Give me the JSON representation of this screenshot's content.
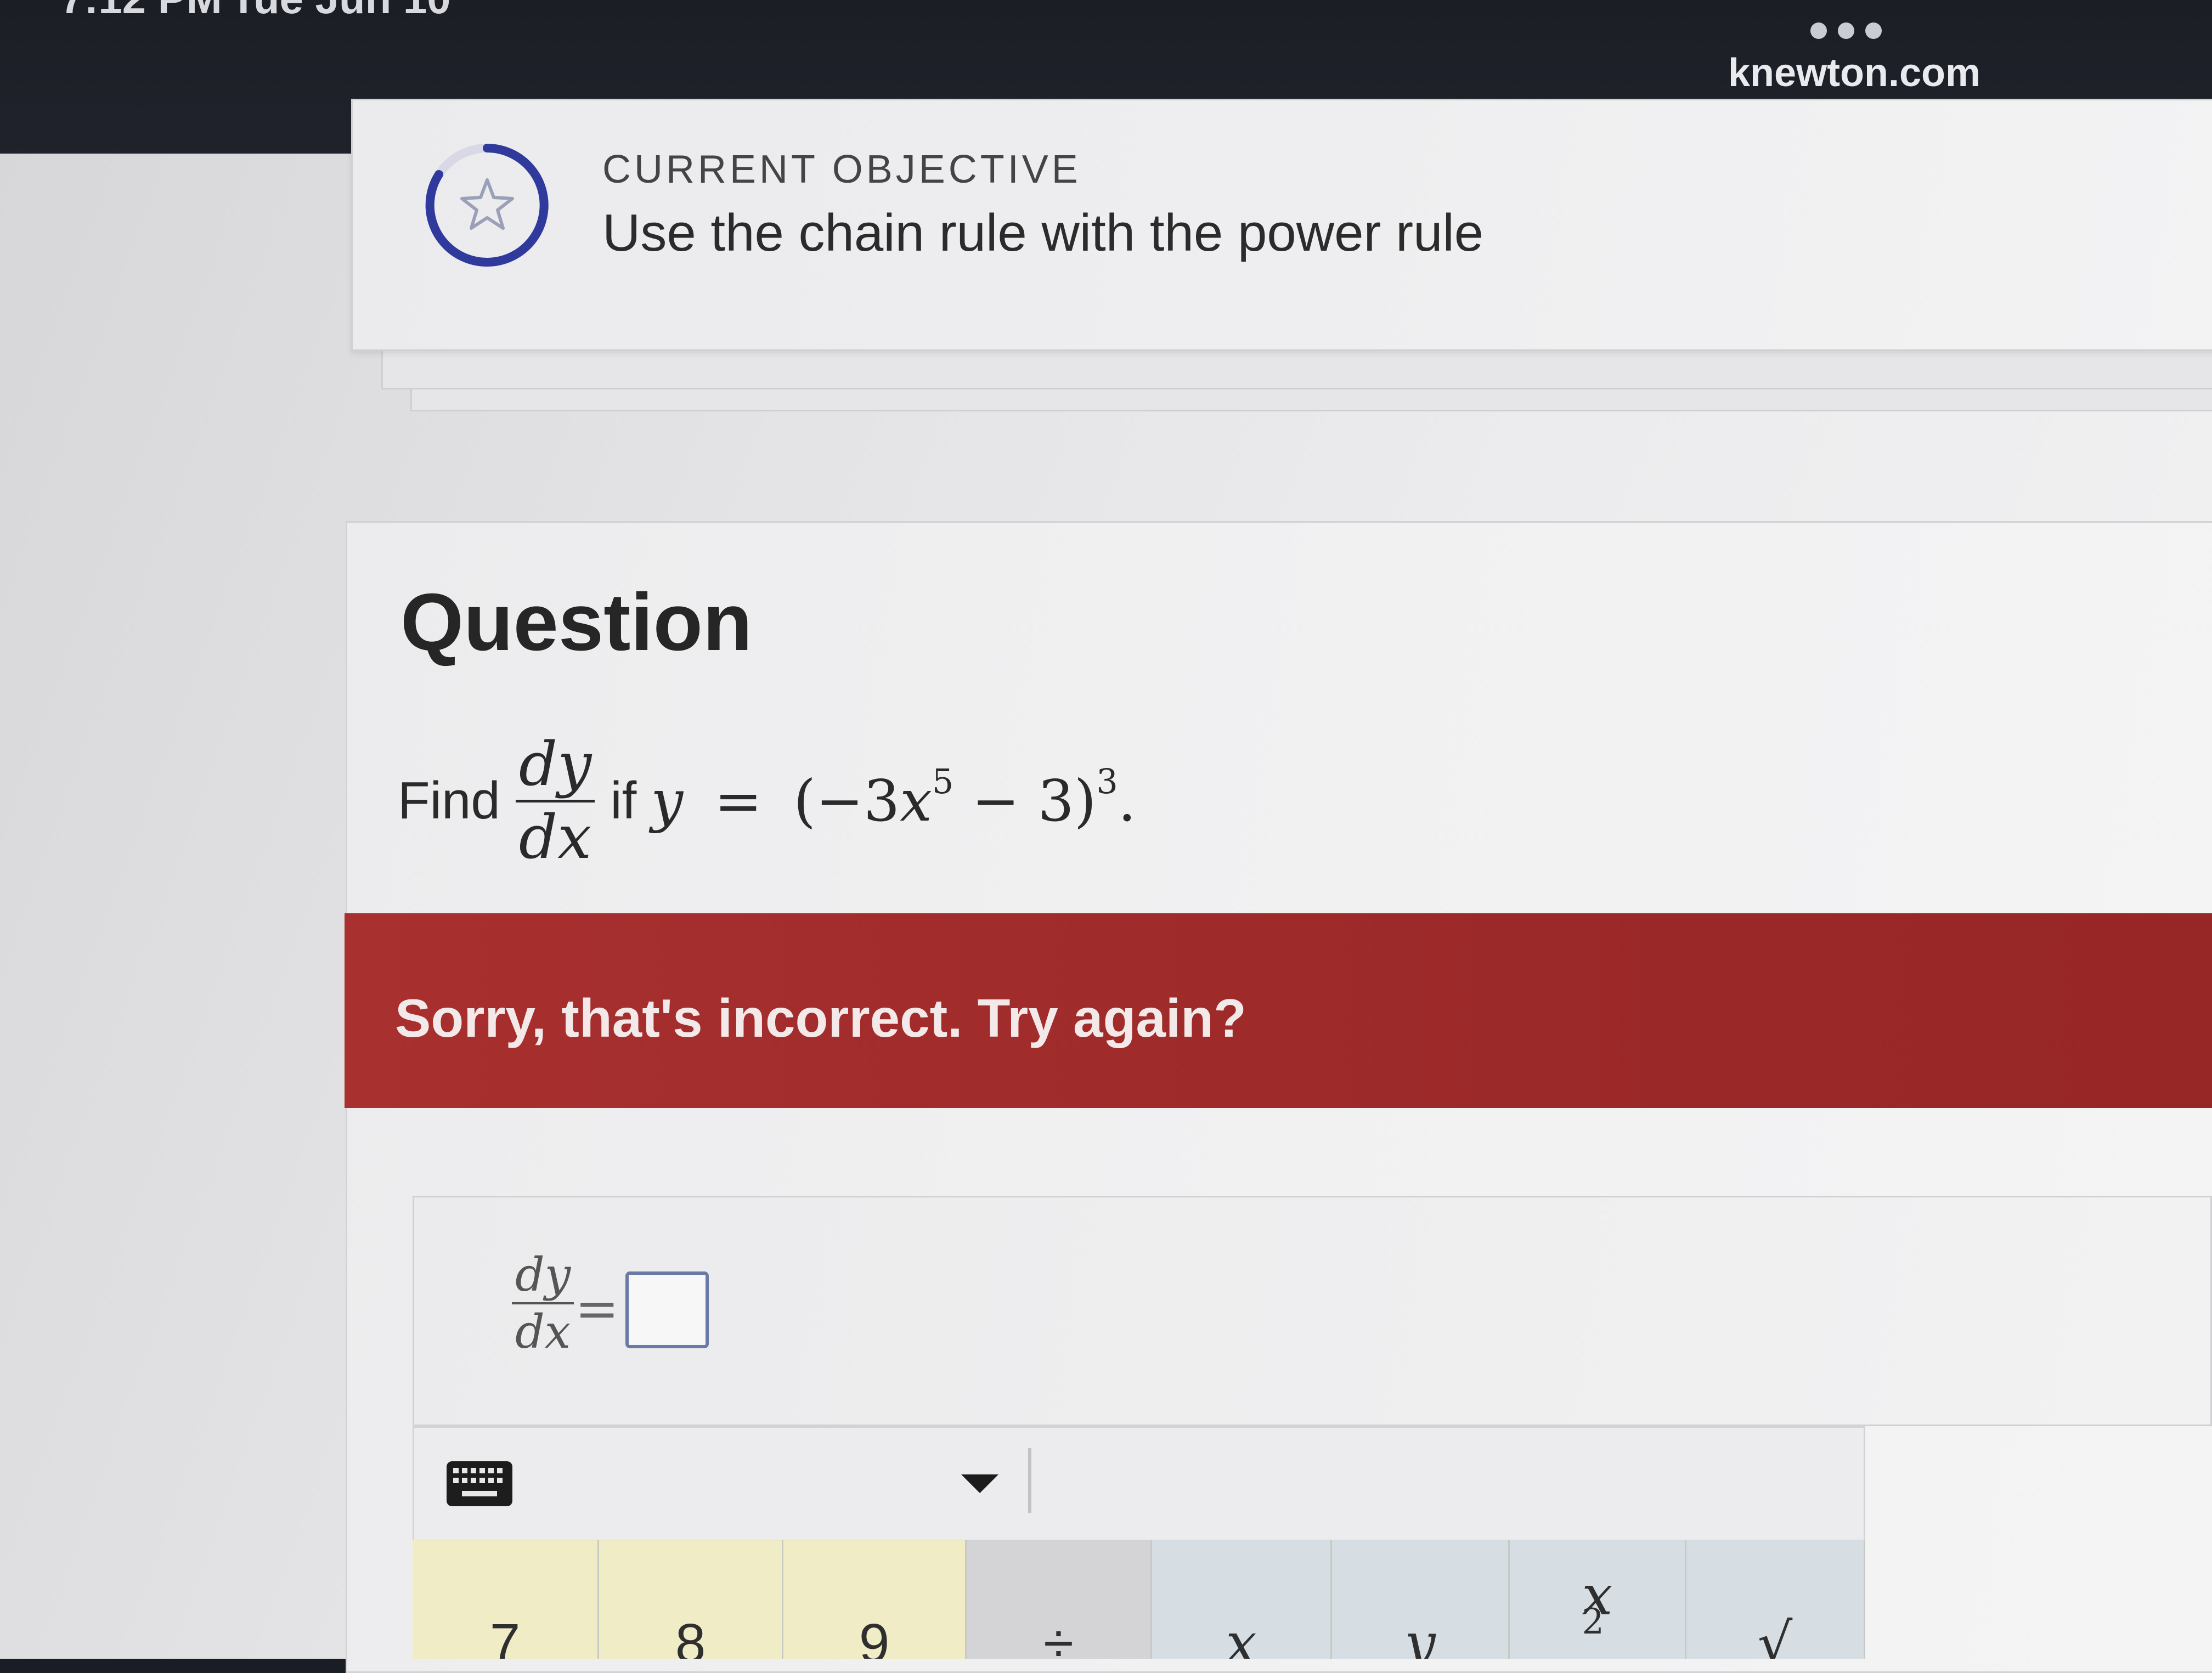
{
  "status_bar": {
    "time": "7:12 PM",
    "date": "Tue Jun 10",
    "url": "knewton.com"
  },
  "objective": {
    "eyebrow": "CURRENT OBJECTIVE",
    "title": "Use the chain rule with the power rule",
    "icon": "star-icon"
  },
  "question": {
    "heading": "Question",
    "prompt_prefix": "Find",
    "frac_num": "dy",
    "frac_den": "dx",
    "prompt_if": "if",
    "expr_y": "y",
    "expr_eq": "=",
    "expr_open": "(−3",
    "expr_x": "x",
    "expr_exp5": "5",
    "expr_minus3": " − 3)",
    "expr_exp3": "3",
    "expr_period": "."
  },
  "feedback": {
    "text": "Sorry, that's incorrect. Try again?",
    "color": "#a12b2b"
  },
  "answer": {
    "label_num": "dy",
    "label_den": "dx",
    "equals": "=",
    "value": ""
  },
  "keypad": {
    "keyboard_icon": "keyboard-icon",
    "caret_icon": "chevron-down-icon",
    "keys": [
      {
        "label": "7"
      },
      {
        "label": "8"
      },
      {
        "label": "9"
      },
      {
        "label": "÷"
      },
      {
        "label": "x"
      },
      {
        "label": "y"
      },
      {
        "label": "x",
        "sup": "2"
      },
      {
        "label": "√"
      }
    ]
  }
}
